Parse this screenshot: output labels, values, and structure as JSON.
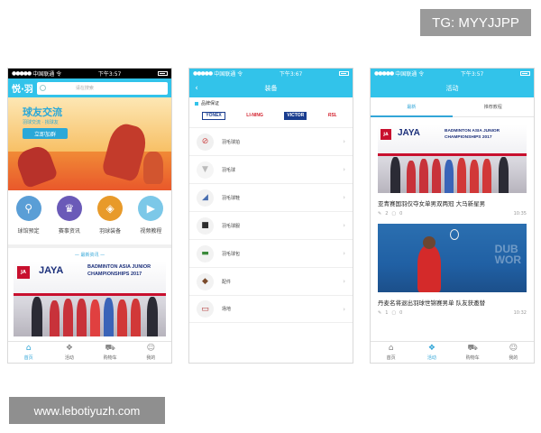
{
  "badges": {
    "tg": "TG: MYYJJPP",
    "website": "www.lebotiyuzh.com"
  },
  "status": {
    "carrier": "中国联通",
    "wifi": "令",
    "time": "下午3:57"
  },
  "status_p2": {
    "carrier": "中国联通",
    "wifi": "令",
    "time": "下午3:67"
  },
  "home": {
    "logo": "悦·羽",
    "search_placeholder": "请在搜索",
    "banner": {
      "title": "球友交流",
      "subtitle": "羽球交流 · 找球友",
      "button": "立即加群"
    },
    "categories": [
      {
        "label": "球馆预定",
        "icon": "⚲",
        "color": "#5a9ed6"
      },
      {
        "label": "赛事资讯",
        "icon": "♛",
        "color": "#6a5ab8"
      },
      {
        "label": "羽球装备",
        "icon": "◈",
        "color": "#e89a2a"
      },
      {
        "label": "视频教程",
        "icon": "▶",
        "color": "#7cc8e8"
      }
    ],
    "news_header": "— 最新资讯 —"
  },
  "jaya": {
    "logo": "JA",
    "name": "JAYA",
    "caption_line1": "BADMINTON ASIA JUNIOR",
    "caption_line2": "CHAMPIONSHIPS 2017"
  },
  "equipment": {
    "title": "装备",
    "back": "‹",
    "brand_title": "品牌保证",
    "brands": [
      "YONEX",
      "LI-NING",
      "VICTOR",
      "RSL"
    ],
    "items": [
      {
        "label": "羽毛球拍",
        "icon": "⊘",
        "color": "#f0f0f0",
        "fg": "#c44"
      },
      {
        "label": "羽毛球",
        "icon": "▼",
        "color": "#f5f5f5",
        "fg": "#bbb"
      },
      {
        "label": "羽毛球鞋",
        "icon": "◢",
        "color": "#f2f2f2",
        "fg": "#4a6fb0"
      },
      {
        "label": "羽毛球服",
        "icon": "■",
        "color": "#f2f2f2",
        "fg": "#2d2d2d"
      },
      {
        "label": "羽毛球包",
        "icon": "▬",
        "color": "#f2f2f2",
        "fg": "#3b8a3b"
      },
      {
        "label": "配件",
        "icon": "◆",
        "color": "#f2f2f2",
        "fg": "#7a4a2a"
      },
      {
        "label": "场地",
        "icon": "▭",
        "color": "#f2f2f2",
        "fg": "#b03030"
      }
    ]
  },
  "activity": {
    "title": "活动",
    "tabs": [
      "最新",
      "推荐教程"
    ],
    "articles": [
      {
        "title": "亚青赛国羽仅夺女单男双两冠 大马新星男",
        "comments": "2",
        "likes": "0",
        "time": "10:35"
      },
      {
        "title": "丹麦名将退出羽球世锦赛男单 队友获邀替",
        "comments": "1",
        "likes": "0",
        "time": "10:32"
      }
    ],
    "dubai": "DUB\nWOR"
  },
  "tabbar": [
    {
      "label": "首页",
      "icon": "⌂"
    },
    {
      "label": "活动",
      "icon": "❖"
    },
    {
      "label": "购物车",
      "icon": "⛟"
    },
    {
      "label": "我的",
      "icon": "☺"
    }
  ],
  "colors": {
    "accent": "#32c3ea",
    "link": "#32a6d8"
  }
}
